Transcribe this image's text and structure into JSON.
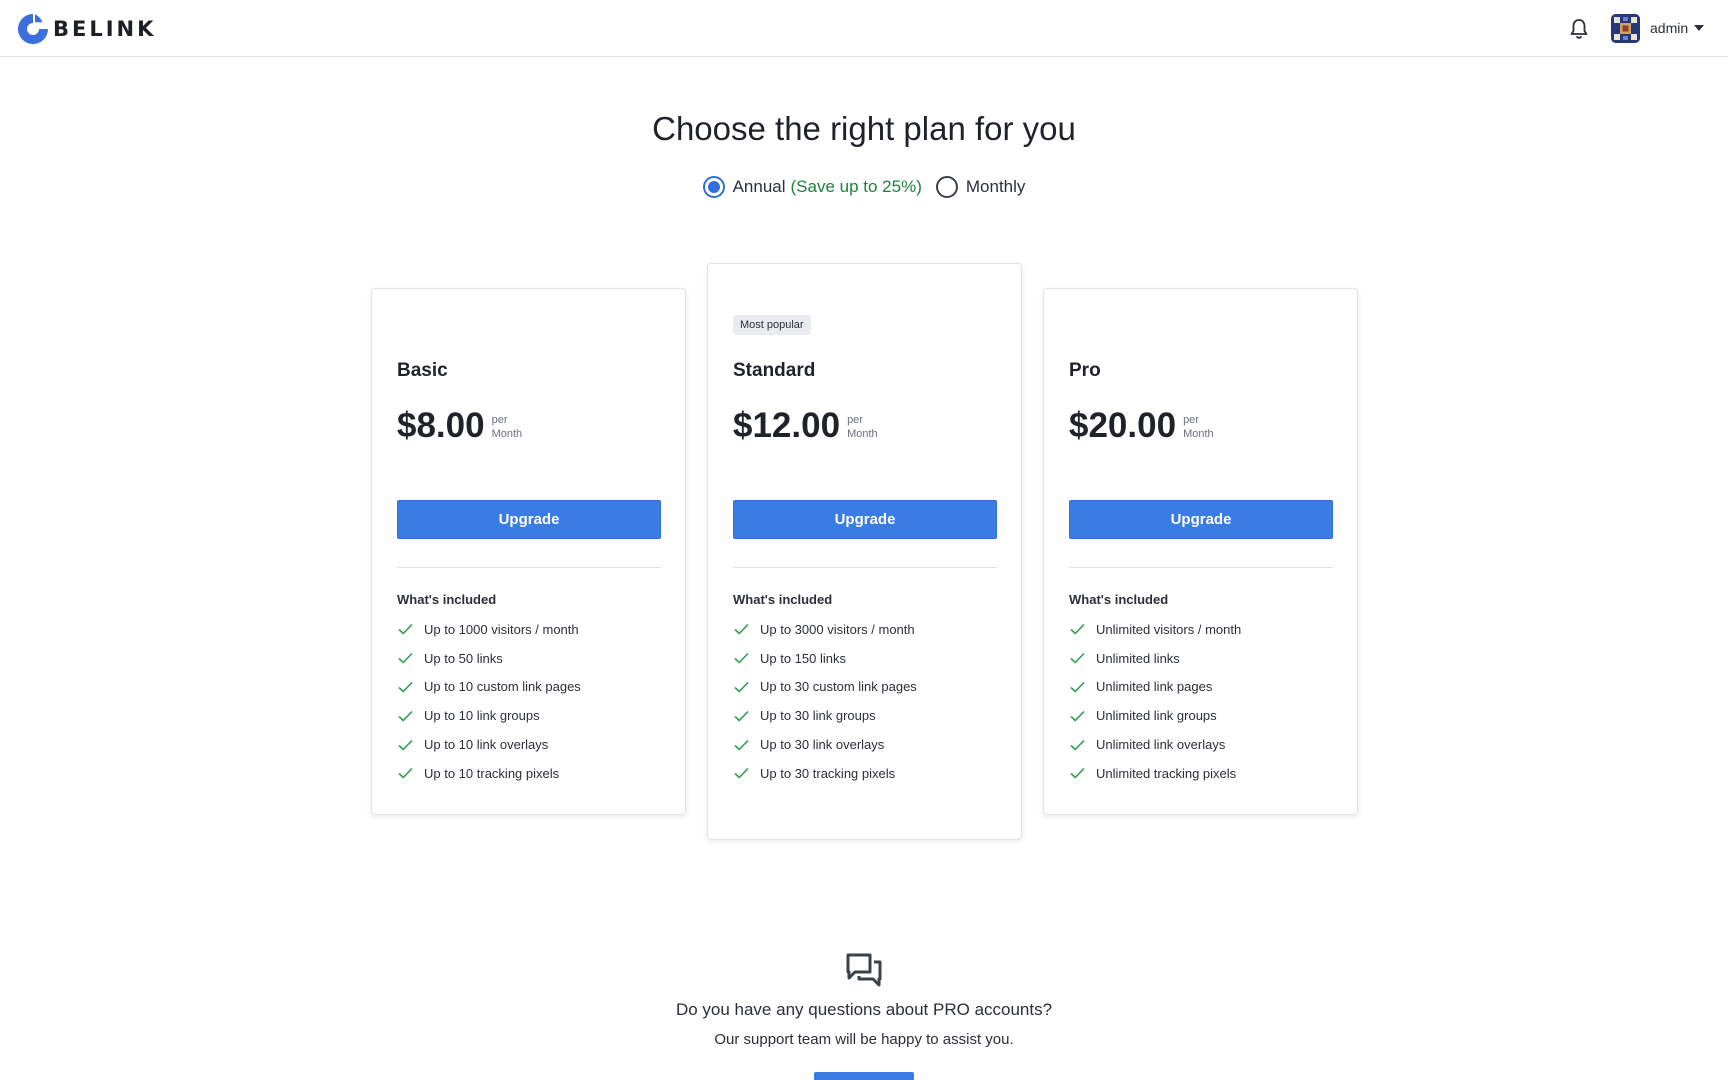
{
  "header": {
    "brand": "BELINK",
    "user_name": "admin",
    "icons": {
      "logo": "belink-logo-icon",
      "notifications": "bell-icon",
      "avatar": "avatar-image",
      "menu": "caret-down-icon"
    }
  },
  "page": {
    "title": "Choose the right plan for you"
  },
  "billing": {
    "annual_label": "Annual",
    "annual_note": "(Save up to 25%)",
    "monthly_label": "Monthly",
    "selected": "annual"
  },
  "plans": [
    {
      "name": "Basic",
      "badge": "",
      "price": "$8.00",
      "per": "per",
      "period": "Month",
      "button": "Upgrade",
      "included_title": "What's included",
      "features": [
        "Up to 1000 visitors / month",
        "Up to 50 links",
        "Up to 10 custom link pages",
        "Up to 10 link groups",
        "Up to 10 link overlays",
        "Up to 10 tracking pixels"
      ]
    },
    {
      "name": "Standard",
      "badge": "Most popular",
      "price": "$12.00",
      "per": "per",
      "period": "Month",
      "button": "Upgrade",
      "included_title": "What's included",
      "features": [
        "Up to 3000 visitors / month",
        "Up to 150 links",
        "Up to 30 custom link pages",
        "Up to 30 link groups",
        "Up to 30 link overlays",
        "Up to 30 tracking pixels"
      ]
    },
    {
      "name": "Pro",
      "badge": "",
      "price": "$20.00",
      "per": "per",
      "period": "Month",
      "button": "Upgrade",
      "included_title": "What's included",
      "features": [
        "Unlimited visitors / month",
        "Unlimited links",
        "Unlimited link pages",
        "Unlimited link groups",
        "Unlimited link overlays",
        "Unlimited tracking pixels"
      ]
    }
  ],
  "support": {
    "question": "Do you have any questions about PRO accounts?",
    "subtitle": "Our support team will be happy to assist you.",
    "icon": "chat-bubbles-icon"
  },
  "colors": {
    "accent": "#3a7be4",
    "check": "#2f9e57",
    "save_note": "#1e7f3c"
  }
}
